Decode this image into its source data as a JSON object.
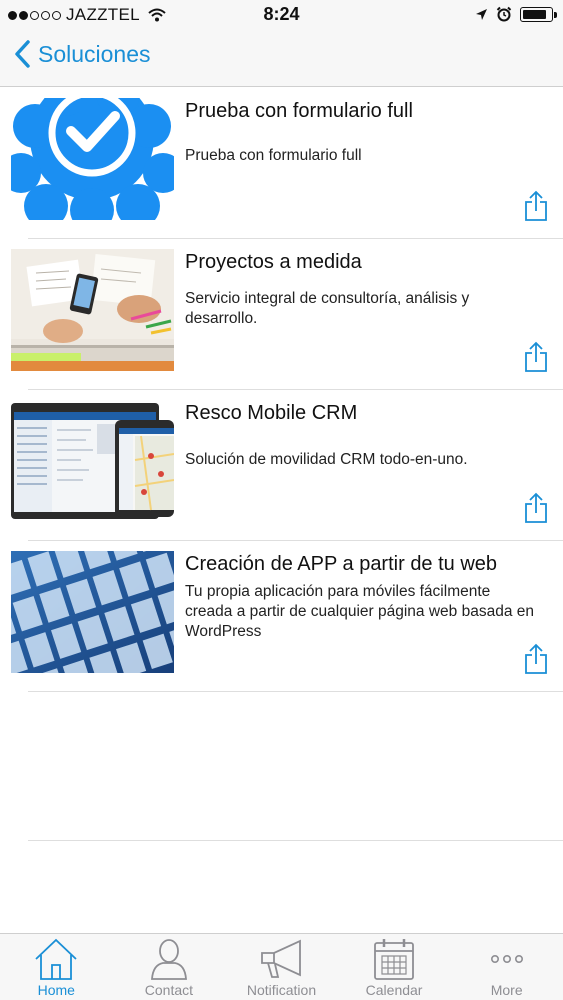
{
  "status_bar": {
    "carrier": "JAZZTEL",
    "time": "8:24",
    "signal_strength": 2,
    "signal_max": 5,
    "battery_level": 0.85
  },
  "nav": {
    "back_label": "Soluciones"
  },
  "items": [
    {
      "title": "Prueba con formulario full",
      "description": "Prueba con formulario full",
      "image": "verified-badge"
    },
    {
      "title": "Proyectos a medida",
      "description": "Servicio integral de consultoría, análisis y desarrollo.",
      "image": "desk-sketches"
    },
    {
      "title": "Resco Mobile CRM",
      "description": "Solución de movilidad CRM todo-en-uno.",
      "image": "crm-devices"
    },
    {
      "title": "Creación de APP a partir de tu web",
      "description": "Tu propia aplicación para móviles fácilmente creada a partir de cualquier página web basada en WordPress",
      "image": "app-screens"
    }
  ],
  "tabs": [
    {
      "label": "Home",
      "icon": "home-icon",
      "active": true
    },
    {
      "label": "Contact",
      "icon": "person-icon",
      "active": false
    },
    {
      "label": "Notification",
      "icon": "megaphone-icon",
      "active": false
    },
    {
      "label": "Calendar",
      "icon": "calendar-icon",
      "active": false
    },
    {
      "label": "More",
      "icon": "more-icon",
      "active": false
    }
  ],
  "colors": {
    "accent": "#1a8fd6",
    "inactive": "#8e8e93",
    "bar_background": "#f7f7f7"
  }
}
